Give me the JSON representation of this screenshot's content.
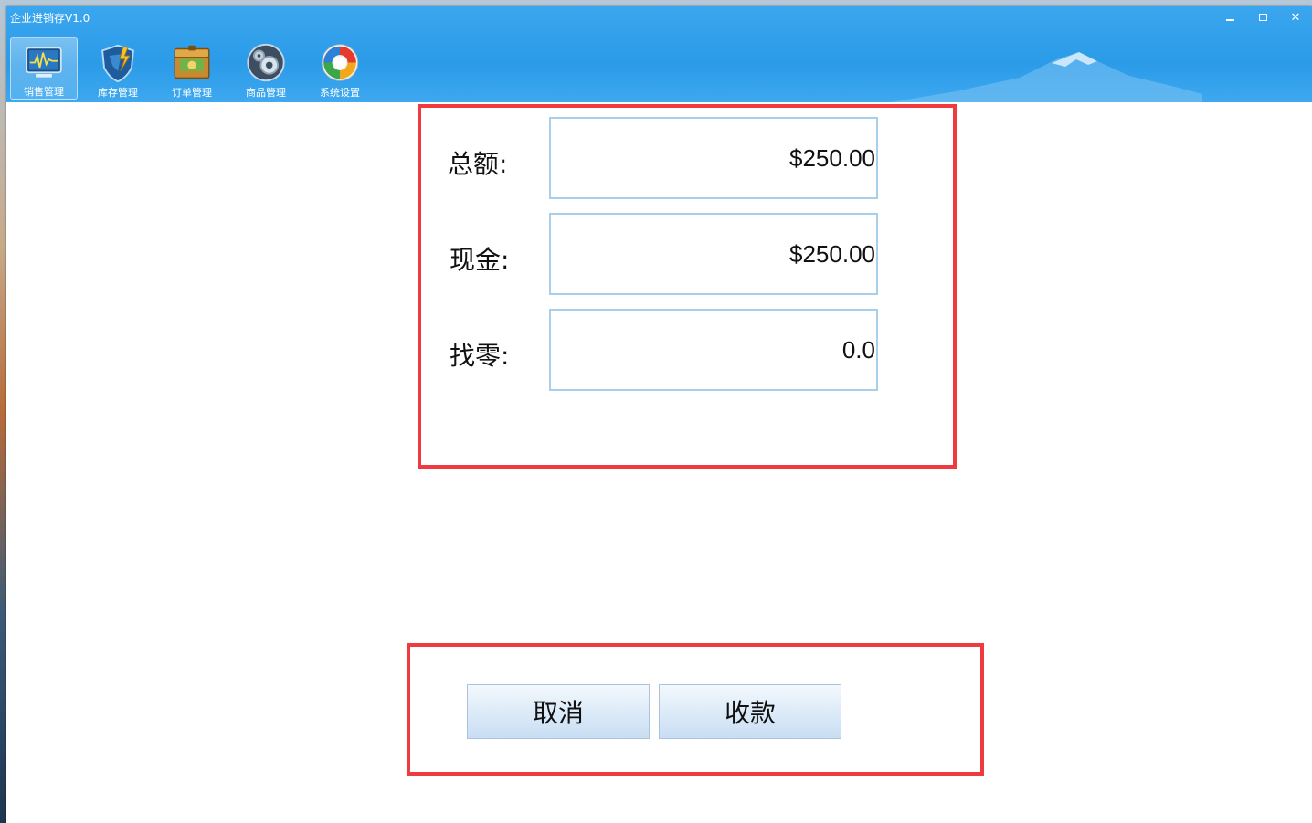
{
  "window": {
    "title": "企业进销存V1.0",
    "controls": {
      "minimize": "minimize",
      "maximize": "maximize",
      "close": "✕"
    }
  },
  "toolbar": {
    "items": [
      {
        "label": "销售管理",
        "icon": "sales-chart-icon",
        "active": true
      },
      {
        "label": "库存管理",
        "icon": "inventory-shield-icon",
        "active": false
      },
      {
        "label": "订单管理",
        "icon": "order-box-icon",
        "active": false
      },
      {
        "label": "商品管理",
        "icon": "product-gear-icon",
        "active": false
      },
      {
        "label": "系统设置",
        "icon": "settings-refresh-icon",
        "active": false
      }
    ]
  },
  "payment": {
    "total_label": "总额:",
    "total_value": "$250.00",
    "cash_label": "现金:",
    "cash_value": "$250.00",
    "change_label": "找零:",
    "change_value": "0.0"
  },
  "actions": {
    "cancel_label": "取消",
    "collect_label": "收款"
  },
  "colors": {
    "titlebar": "#2b9be8",
    "highlight": "#ef3b3f",
    "field_border": "#a9d0ea"
  }
}
